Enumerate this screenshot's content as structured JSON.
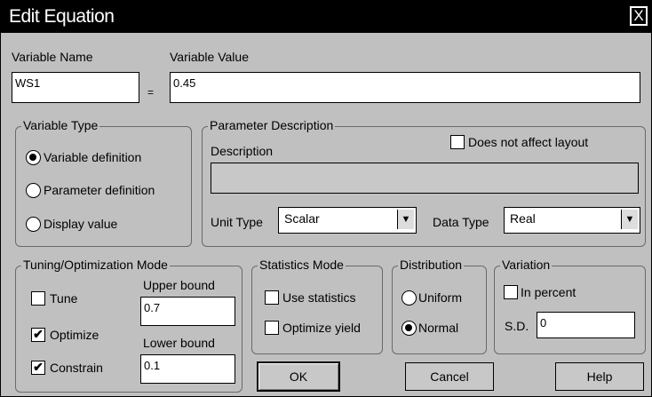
{
  "window": {
    "title": "Edit Equation",
    "close_symbol": "X"
  },
  "variable": {
    "name_label": "Variable Name",
    "value_label": "Variable Value",
    "name_value": "WS1",
    "equals": "=",
    "value_value": "0.45"
  },
  "variable_type": {
    "legend": "Variable Type",
    "options": [
      {
        "label": "Variable definition",
        "selected": true
      },
      {
        "label": "Parameter definition",
        "selected": false
      },
      {
        "label": "Display value",
        "selected": false
      }
    ]
  },
  "parameter_description": {
    "legend": "Parameter Description",
    "description_label": "Description",
    "does_not_affect_layout_label": "Does not affect layout",
    "does_not_affect_layout_checked": false,
    "description_value": "",
    "unit_type_label": "Unit Type",
    "unit_type_value": "Scalar",
    "data_type_label": "Data Type",
    "data_type_value": "Real"
  },
  "tuning": {
    "legend": "Tuning/Optimization Mode",
    "tune_label": "Tune",
    "tune_checked": false,
    "optimize_label": "Optimize",
    "optimize_checked": true,
    "constrain_label": "Constrain",
    "constrain_checked": true,
    "upper_bound_label": "Upper bound",
    "upper_bound_value": "0.7",
    "lower_bound_label": "Lower bound",
    "lower_bound_value": "0.1"
  },
  "statistics": {
    "legend": "Statistics Mode",
    "use_statistics_label": "Use statistics",
    "use_statistics_checked": false,
    "optimize_yield_label": "Optimize yield",
    "optimize_yield_checked": false
  },
  "distribution": {
    "legend": "Distribution",
    "uniform_label": "Uniform",
    "uniform_selected": false,
    "normal_label": "Normal",
    "normal_selected": true
  },
  "variation": {
    "legend": "Variation",
    "in_percent_label": "In percent",
    "in_percent_checked": false,
    "sd_label": "S.D.",
    "sd_value": "0"
  },
  "buttons": {
    "ok": "OK",
    "cancel": "Cancel",
    "help": "Help"
  },
  "icons": {
    "dropdown": "chevron-down-icon",
    "check_mark": "✔"
  }
}
